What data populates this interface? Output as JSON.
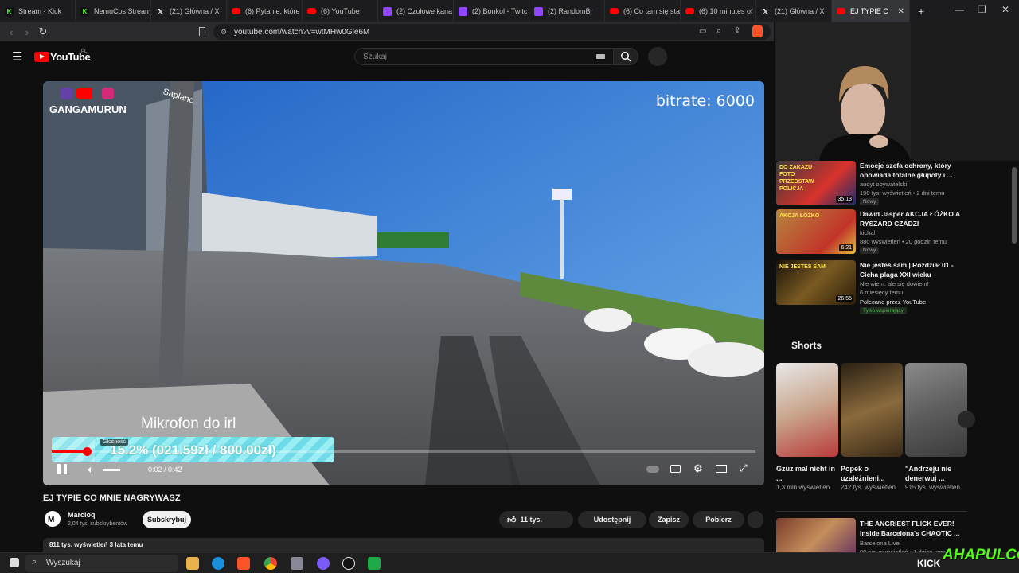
{
  "tabs": [
    {
      "label": "Stream - Kick",
      "icon": "kick-icon",
      "color": "#53fc18"
    },
    {
      "label": "NemuCos Stream",
      "icon": "kick-icon",
      "color": "#53fc18"
    },
    {
      "label": "(21) Główna / X",
      "icon": "x-icon",
      "color": "#ffffff"
    },
    {
      "label": "(6) Pytanie, które",
      "icon": "youtube-icon",
      "color": "#ff0000"
    },
    {
      "label": "(6) YouTube",
      "icon": "youtube-icon",
      "color": "#ff0000"
    },
    {
      "label": "(2) Czołowe kana",
      "icon": "twitch-icon",
      "color": "#9146ff"
    },
    {
      "label": "(2) Bonkol - Twitc",
      "icon": "twitch-icon",
      "color": "#9146ff"
    },
    {
      "label": "(2) RandomBr",
      "icon": "twitch-icon",
      "color": "#9146ff"
    },
    {
      "label": "(6) Co tam się sta",
      "icon": "youtube-icon",
      "color": "#ff0000"
    },
    {
      "label": "(6) 10 minutes of",
      "icon": "youtube-icon",
      "color": "#ff0000"
    },
    {
      "label": "(21) Główna / X",
      "icon": "x-icon",
      "color": "#ffffff"
    }
  ],
  "active_tab": {
    "label": "EJ TYPIE C",
    "icon": "youtube-icon"
  },
  "address": {
    "url": "youtube.com/watch?v=wtMHw0Gle6M"
  },
  "yt": {
    "logo": "YouTube",
    "region": "PL",
    "search_placeholder": "Szukaj"
  },
  "player": {
    "bitrate_overlay": "bitrate: 6000",
    "channel_watermark": "GANGAMURUN",
    "store_sign": "Saplanc",
    "donation_title": "Mikrofon do irl",
    "donation_bar_text": "15.2% (021.59zł / 800.00zł)",
    "donation_progress": 0.152,
    "volume_tooltip": "Głośność",
    "time": "0:02 / 0:42",
    "progress": 0.05
  },
  "video": {
    "title": "EJ TYPIE CO MNIE NAGRYWASZ",
    "channel": "Marcioq",
    "subs": "2,04 tys. subskrybentów",
    "subscribe": "Subskrybuj",
    "likes": "11 tys.",
    "share": "Udostępnij",
    "save": "Zapisz",
    "download": "Pobierz",
    "views_date": "811 tys. wyświetleń  3 lata temu"
  },
  "recs": [
    {
      "title": "Emocje szefa ochrony, który opowiada totalne głupoty i ...",
      "channel": "audyt obywatelski",
      "meta": "190 tys. wyświetleń • 2 dni temu",
      "badge": "Nowy",
      "duration": "35:13",
      "thumb_text": "DO ZAKAZU FOTO PRZEDSTAW POLICJA"
    },
    {
      "title": "Dawid Jasper AKCJA ŁÓŻKO A RYSZARD CZADZI",
      "channel": "kichal",
      "meta": "880 wyświetleń • 20 godzin temu",
      "badge": "Nowy",
      "duration": "6:21",
      "thumb_text": "AKCJA ŁÓŻKO"
    },
    {
      "title": "Nie jesteś sam | Rozdział 01 - Cicha plaga XXI wieku",
      "channel": "Nie wiem, ale się dowiem!",
      "meta": "6 miesięcy temu",
      "extra": "Polecane przez YouTube",
      "badge": "Tylko wspierający",
      "duration": "26:55",
      "thumb_text": "NIE JESTEŚ SAM"
    }
  ],
  "shorts": {
    "heading": "Shorts",
    "items": [
      {
        "title": "Gzuz mal nicht in ...",
        "views": "1,3 mln wyświetleń"
      },
      {
        "title": "Popek o uzależnieni...",
        "views": "242 tys. wyświetleń"
      },
      {
        "title": "\"Andrzeju nie denerwuj ...",
        "views": "915 tys. wyświetleń"
      }
    ]
  },
  "rec_bottom": {
    "title": "THE ANGRIEST FLICK EVER! Inside Barcelona's CHAOTIC ...",
    "channel": "Barcelona Live",
    "meta": "90 tys. wyświetleń • 1 dzień temu"
  },
  "taskbar": {
    "search": "Wyszukaj",
    "kick_logo": "KICK",
    "streamer_logo": "AHAPULCO"
  },
  "colors": {
    "youtube_red": "#ff0000",
    "kick_green": "#53fc18",
    "donation_cyan": "#7fe6f0"
  }
}
